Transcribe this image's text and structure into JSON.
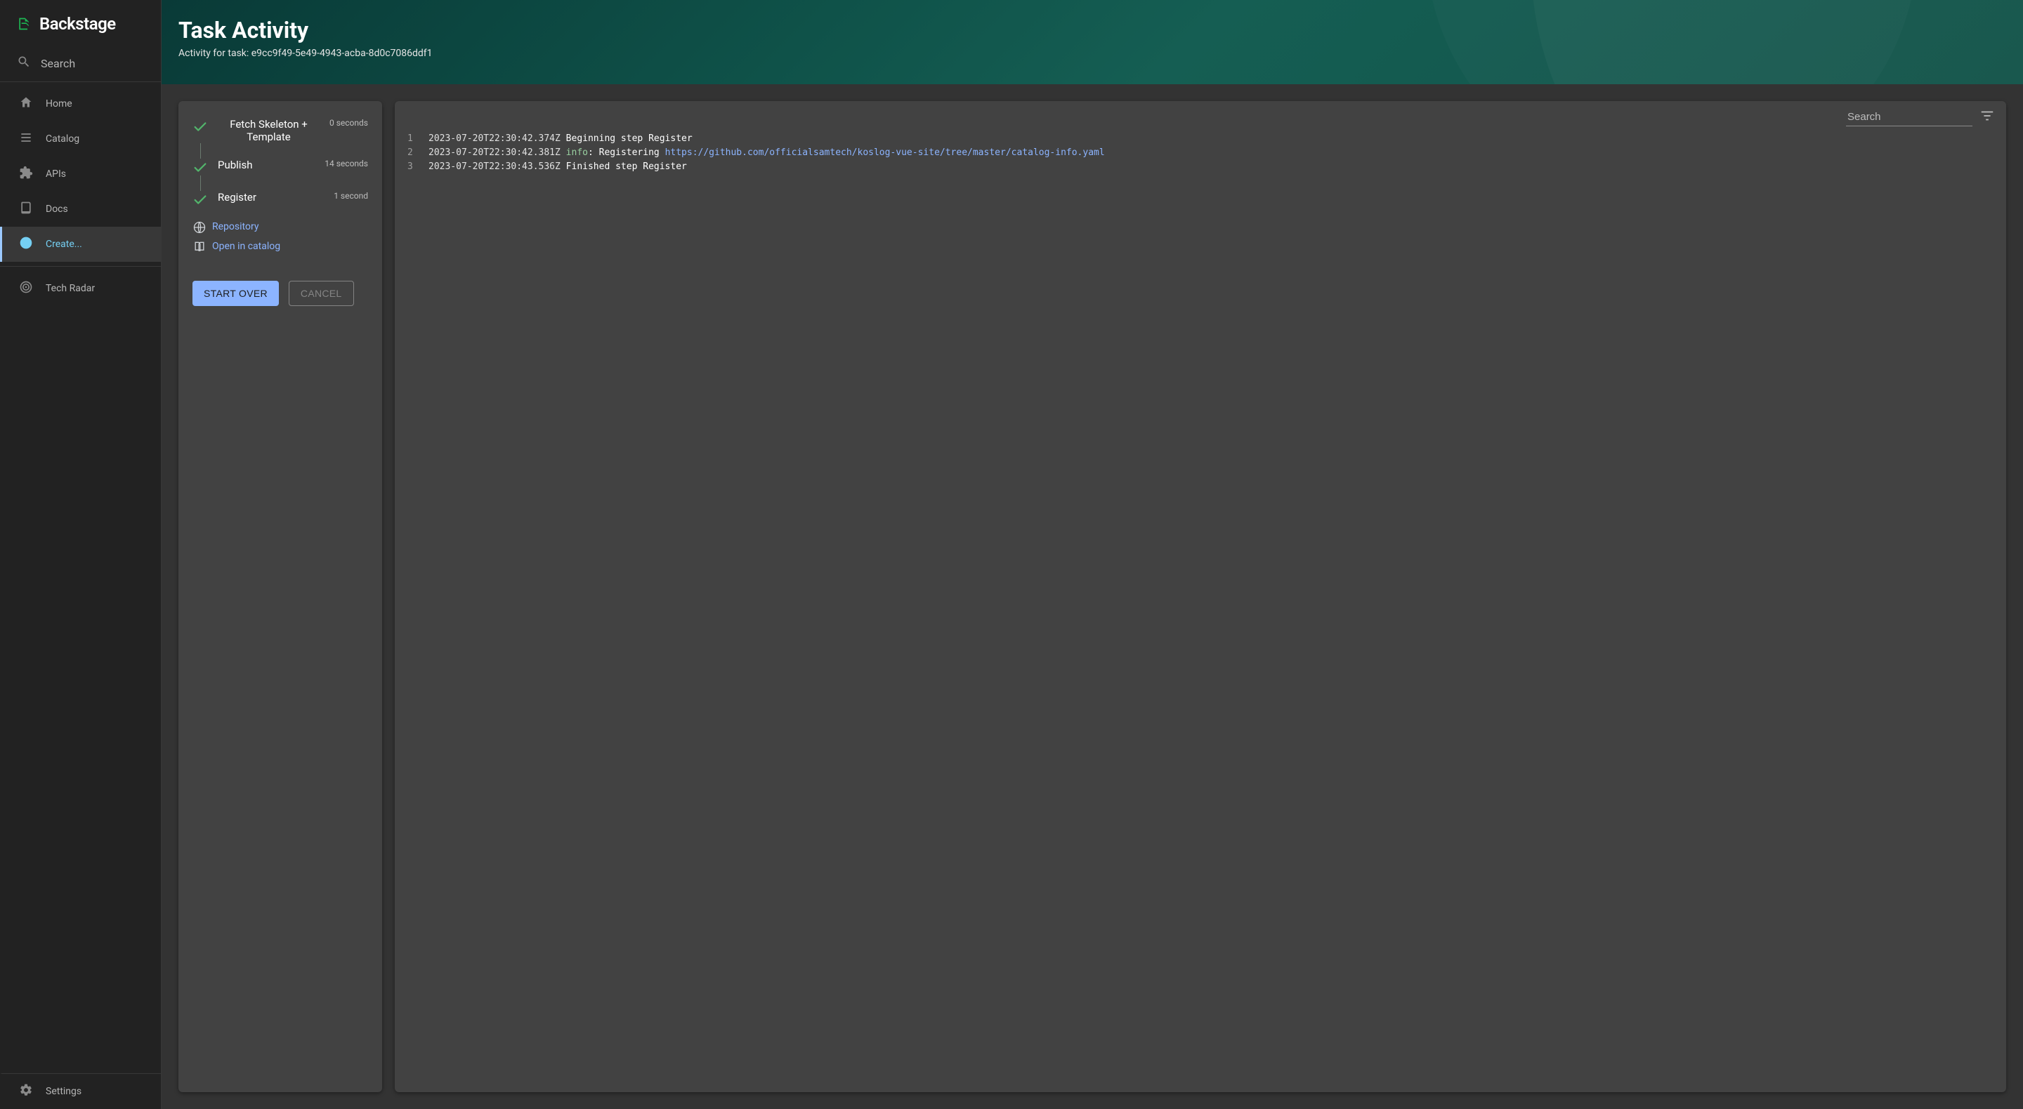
{
  "brand": {
    "name": "Backstage"
  },
  "search": {
    "label": "Search"
  },
  "nav": {
    "items": [
      {
        "label": "Home"
      },
      {
        "label": "Catalog"
      },
      {
        "label": "APIs"
      },
      {
        "label": "Docs"
      },
      {
        "label": "Create..."
      },
      {
        "label": "Tech Radar"
      }
    ]
  },
  "settings": {
    "label": "Settings"
  },
  "header": {
    "title": "Task Activity",
    "subtitle": "Activity for task: e9cc9f49-5e49-4943-acba-8d0c7086ddf1"
  },
  "steps": [
    {
      "title": "Fetch Skeleton + Template",
      "duration": "0 seconds"
    },
    {
      "title": "Publish",
      "duration": "14 seconds"
    },
    {
      "title": "Register",
      "duration": "1 second"
    }
  ],
  "links": {
    "repository": "Repository",
    "open_catalog": "Open in catalog"
  },
  "buttons": {
    "start_over": "START OVER",
    "cancel": "CANCEL"
  },
  "log": {
    "search_placeholder": "Search",
    "lines": [
      {
        "n": "1",
        "ts": "2023-07-20T22:30:42.374Z",
        "text": " Beginning step Register"
      },
      {
        "n": "2",
        "ts": "2023-07-20T22:30:42.381Z",
        "level": "info",
        "text": ": Registering ",
        "url": "https://github.com/officialsamtech/koslog-vue-site/tree/master/catalog-info.yaml"
      },
      {
        "n": "3",
        "ts": "2023-07-20T22:30:43.536Z",
        "text": " Finished step Register"
      }
    ]
  }
}
